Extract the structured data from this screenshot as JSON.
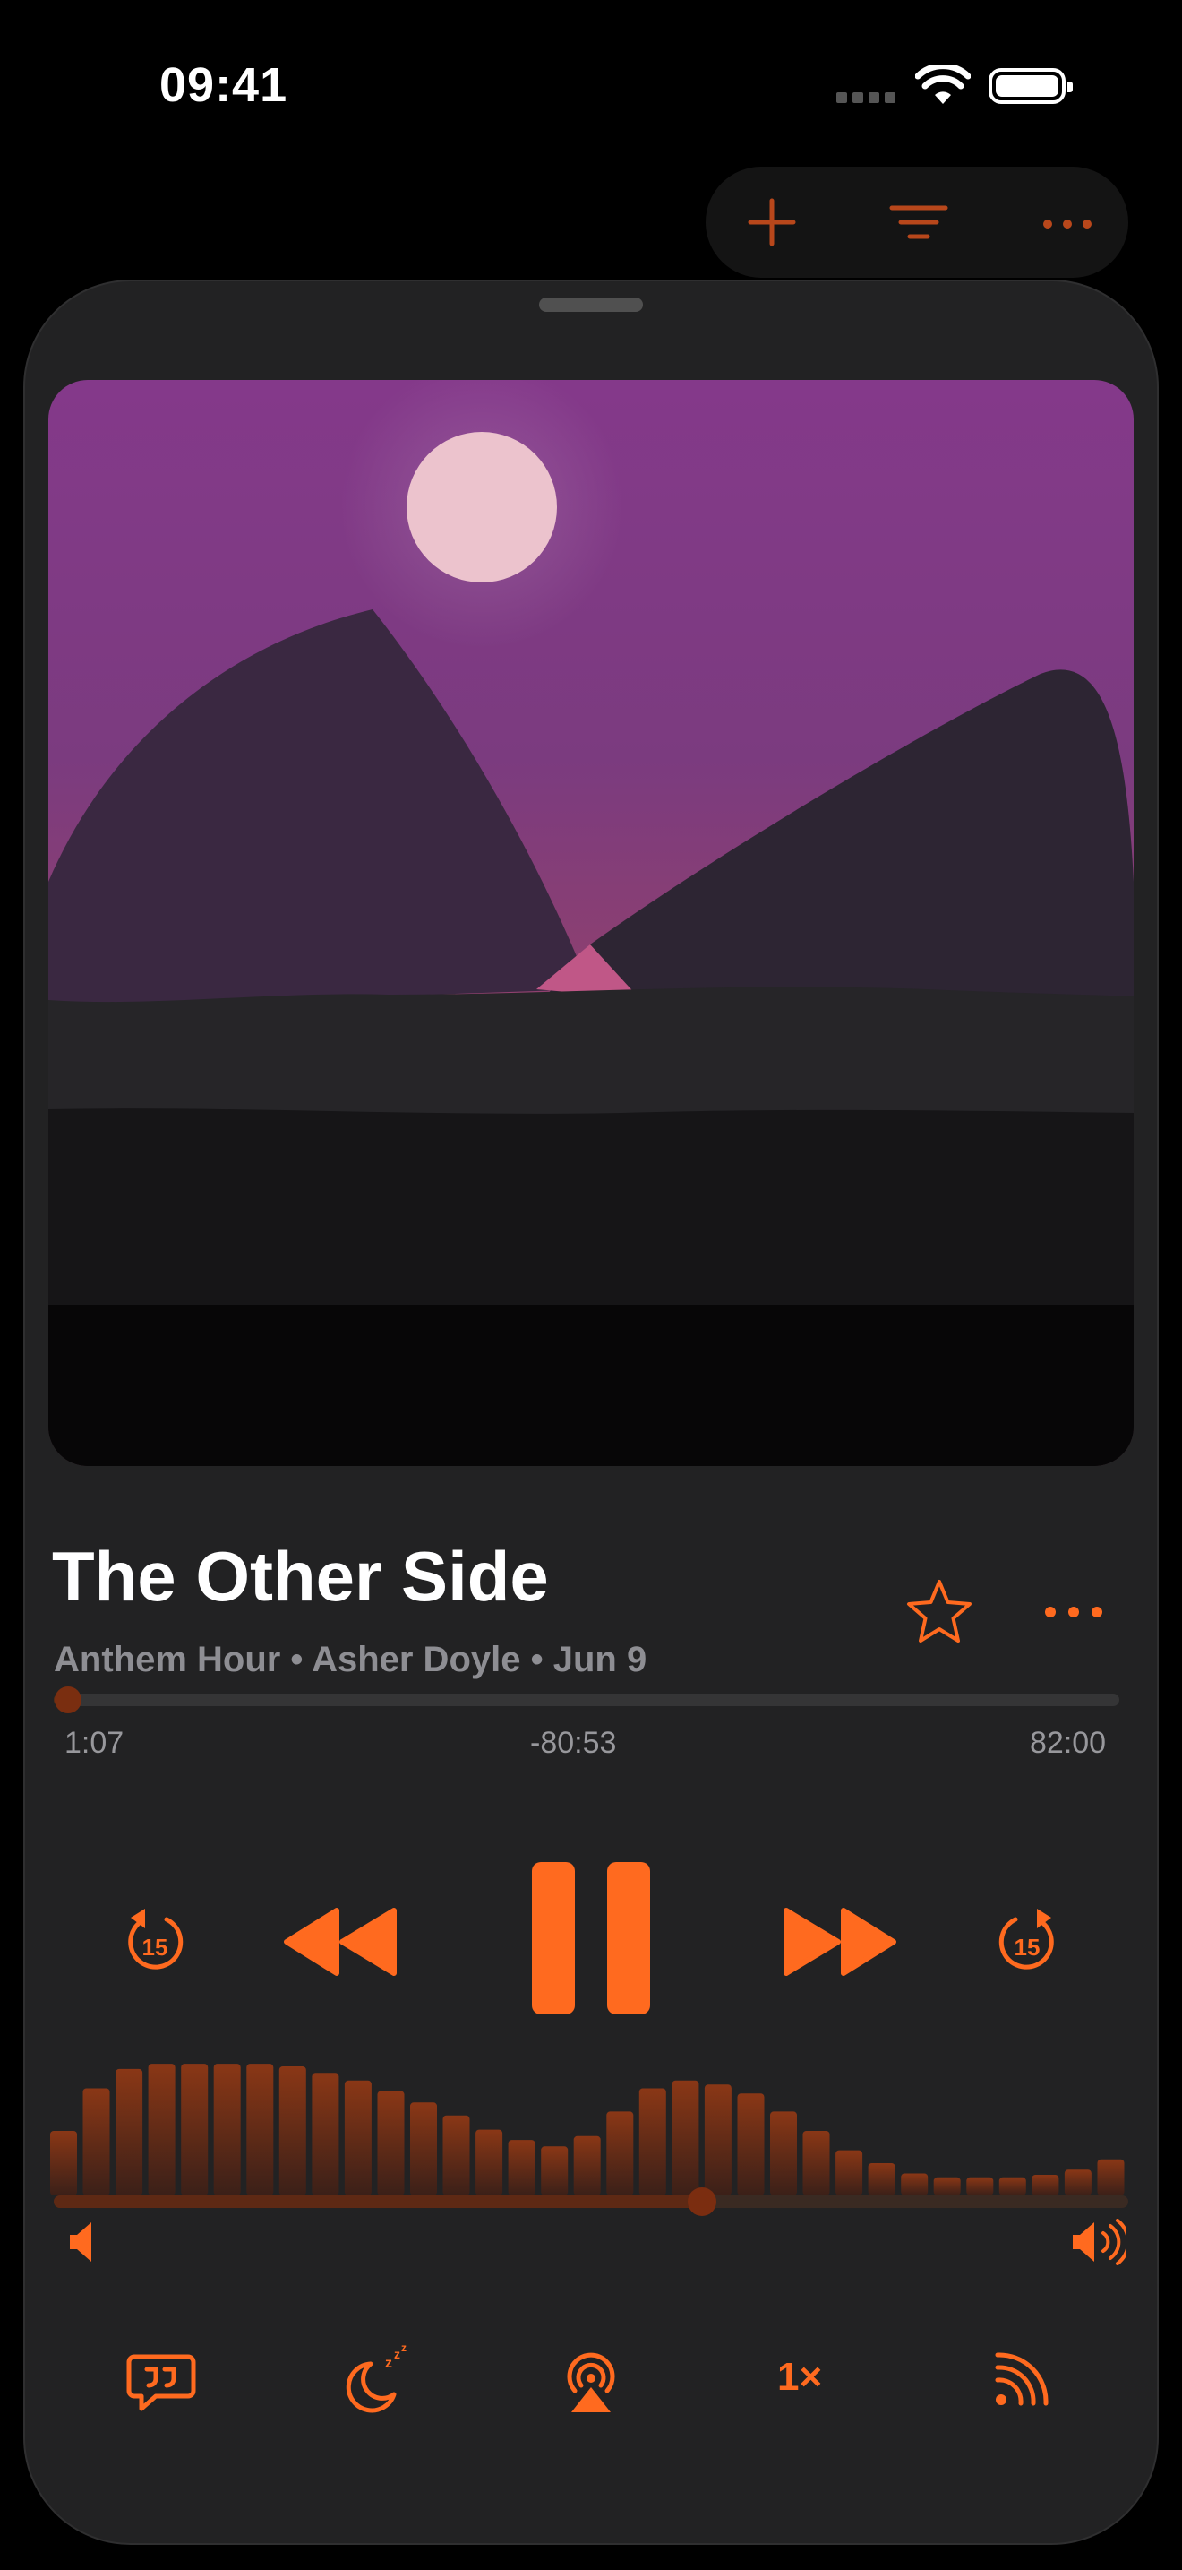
{
  "status_bar": {
    "time": "09:41",
    "icons": [
      "cellular-signal-icon",
      "wifi-icon",
      "battery-icon"
    ]
  },
  "top_actions": {
    "icons": [
      "plus-icon",
      "filter-icon",
      "more-horizontal-icon"
    ]
  },
  "now_playing": {
    "episode_title": "The Other Side",
    "meta": "Anthem Hour • Asher Doyle • Jun 9",
    "elapsed": "1:07",
    "remaining": "-80:53",
    "duration": "82:00",
    "progress_fraction": 0.0136
  },
  "playback": {
    "skip_back_seconds": "15",
    "skip_forward_seconds": "15",
    "state": "playing"
  },
  "volume": {
    "level_fraction": 0.603,
    "eq_levels": [
      0.5,
      0.83,
      0.98,
      1.02,
      1.02,
      1.02,
      1.02,
      1.0,
      0.95,
      0.89,
      0.81,
      0.72,
      0.62,
      0.51,
      0.43,
      0.38,
      0.46,
      0.65,
      0.83,
      0.89,
      0.86,
      0.79,
      0.65,
      0.5,
      0.35,
      0.25,
      0.17,
      0.14,
      0.14,
      0.14,
      0.16,
      0.2,
      0.28
    ]
  },
  "bottom_bar": {
    "speed_label": "1×",
    "icons": [
      "chapters-icon",
      "sleep-timer-icon",
      "airplay-icon",
      "playback-speed-icon",
      "broadcast-icon"
    ]
  },
  "colors": {
    "accent": "#ff6a1f",
    "sheet_background": "#222223",
    "art_sky_top": "#84398a",
    "art_moon": "#ecc3cd"
  }
}
